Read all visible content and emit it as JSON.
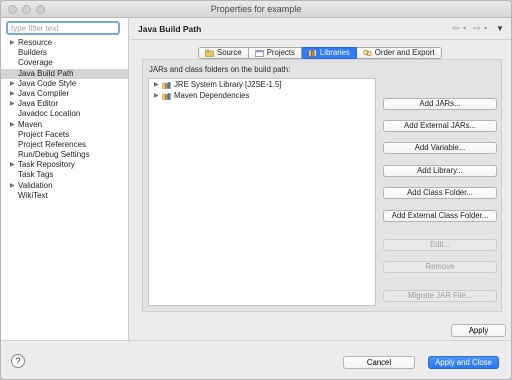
{
  "window": {
    "title": "Properties for example"
  },
  "sidebar": {
    "filter_placeholder": "type filter text",
    "items": [
      {
        "label": "Resource",
        "expandable": true
      },
      {
        "label": "Builders",
        "expandable": false
      },
      {
        "label": "Coverage",
        "expandable": false
      },
      {
        "label": "Java Build Path",
        "expandable": false,
        "selected": true
      },
      {
        "label": "Java Code Style",
        "expandable": true
      },
      {
        "label": "Java Compiler",
        "expandable": true
      },
      {
        "label": "Java Editor",
        "expandable": true
      },
      {
        "label": "Javadoc Location",
        "expandable": false
      },
      {
        "label": "Maven",
        "expandable": true
      },
      {
        "label": "Project Facets",
        "expandable": false
      },
      {
        "label": "Project References",
        "expandable": false
      },
      {
        "label": "Run/Debug Settings",
        "expandable": false
      },
      {
        "label": "Task Repository",
        "expandable": true
      },
      {
        "label": "Task Tags",
        "expandable": false
      },
      {
        "label": "Validation",
        "expandable": true
      },
      {
        "label": "WikiText",
        "expandable": false
      }
    ]
  },
  "page": {
    "title": "Java Build Path",
    "tabs": [
      {
        "label": "Source",
        "icon": "source-folder-icon",
        "active": false
      },
      {
        "label": "Projects",
        "icon": "projects-icon",
        "active": false
      },
      {
        "label": "Libraries",
        "icon": "libraries-icon",
        "active": true
      },
      {
        "label": "Order and Export",
        "icon": "order-export-icon",
        "active": false
      }
    ],
    "list_label": "JARs and class folders on the build path:",
    "libraries": [
      {
        "label": "JRE System Library [J2SE-1.5]"
      },
      {
        "label": "Maven Dependencies"
      }
    ],
    "buttons": [
      {
        "label": "Add JARs...",
        "enabled": true
      },
      {
        "label": "Add External JARs...",
        "enabled": true
      },
      {
        "label": "Add Variable...",
        "enabled": true
      },
      {
        "label": "Add Library...",
        "enabled": true
      },
      {
        "label": "Add Class Folder...",
        "enabled": true
      },
      {
        "label": "Add External Class Folder...",
        "enabled": true
      },
      {
        "label": "Edit...",
        "enabled": false
      },
      {
        "label": "Remove",
        "enabled": false
      },
      {
        "label": "Migrate JAR File...",
        "enabled": false
      }
    ],
    "apply_label": "Apply"
  },
  "footer": {
    "help_label": "?",
    "cancel_label": "Cancel",
    "apply_close_label": "Apply and Close"
  },
  "colors": {
    "accent": "#2f7bf6",
    "selection": "#d5d5d5",
    "focus_ring": "#7aa7e3"
  }
}
